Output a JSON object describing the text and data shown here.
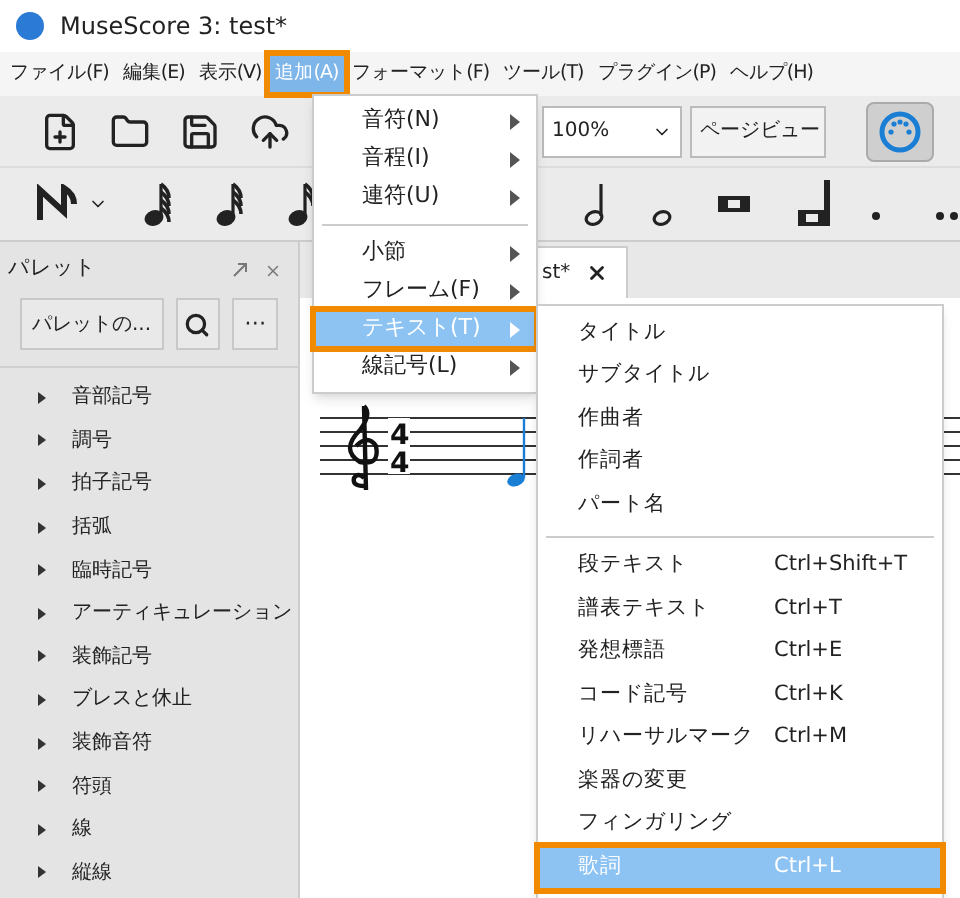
{
  "window": {
    "title": "MuseScore 3: test*"
  },
  "menu_bar": [
    {
      "label": "ファイル(F)",
      "selected": false
    },
    {
      "label": "編集(E)",
      "selected": false
    },
    {
      "label": "表示(V)",
      "selected": false
    },
    {
      "label": "追加(A)",
      "selected": true
    },
    {
      "label": "フォーマット(F)",
      "selected": false
    },
    {
      "label": "ツール(T)",
      "selected": false
    },
    {
      "label": "プラグイン(P)",
      "selected": false
    },
    {
      "label": "ヘルプ(H)",
      "selected": false
    }
  ],
  "toolbar": {
    "zoom": "100%",
    "view": "ページビュー",
    "midi_input_on": true
  },
  "palette": {
    "title": "パレット",
    "add_button": "パレットの...",
    "more_button": "⋯",
    "items": [
      "音部記号",
      "調号",
      "拍子記号",
      "括弧",
      "臨時記号",
      "アーティキュレーション",
      "装飾記号",
      "ブレスと休止",
      "装飾音符",
      "符頭",
      "線",
      "縦線"
    ]
  },
  "score_tab": {
    "label": "st*"
  },
  "score": {
    "time_signature": [
      "4",
      "4"
    ]
  },
  "add_menu": {
    "groups": [
      [
        {
          "label": "音符(N)",
          "selected": false
        },
        {
          "label": "音程(I)",
          "selected": false
        },
        {
          "label": "連符(U)",
          "selected": false
        }
      ],
      [
        {
          "label": "小節",
          "selected": false
        },
        {
          "label": "フレーム(F)",
          "selected": false
        },
        {
          "label": "テキスト(T)",
          "selected": true
        },
        {
          "label": "線記号(L)",
          "selected": false
        }
      ]
    ]
  },
  "text_submenu": {
    "groups": [
      [
        {
          "label": "タイトル",
          "selected": false
        },
        {
          "label": "サブタイトル",
          "selected": false
        },
        {
          "label": "作曲者",
          "selected": false
        },
        {
          "label": "作詞者",
          "selected": false
        },
        {
          "label": "パート名",
          "selected": false
        }
      ],
      [
        {
          "label": "段テキスト",
          "shortcut": "Ctrl+Shift+T",
          "selected": false
        },
        {
          "label": "譜表テキスト",
          "shortcut": "Ctrl+T",
          "selected": false
        },
        {
          "label": "発想標語",
          "shortcut": "Ctrl+E",
          "selected": false
        },
        {
          "label": "コード記号",
          "shortcut": "Ctrl+K",
          "selected": false
        },
        {
          "label": "リハーサルマーク",
          "shortcut": "Ctrl+M",
          "selected": false
        },
        {
          "label": "楽器の変更",
          "selected": false
        },
        {
          "label": "フィンガリング",
          "selected": false
        },
        {
          "label": "歌詞",
          "shortcut": "Ctrl+L",
          "selected": true
        }
      ]
    ]
  }
}
